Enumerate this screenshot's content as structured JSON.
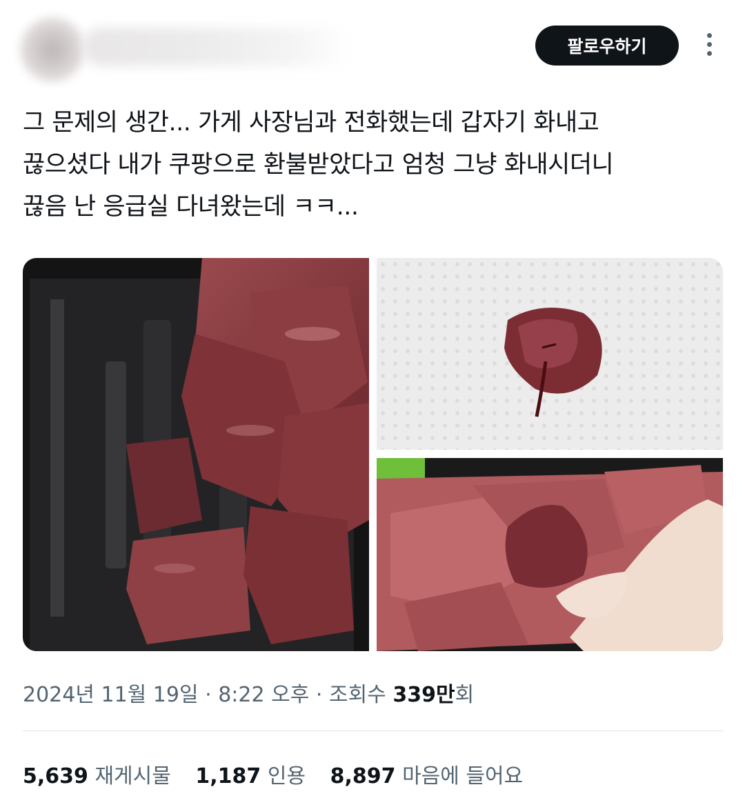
{
  "header": {
    "follow_label": "팔로우하기"
  },
  "tweet": {
    "lines": [
      "그 문제의 생간... 가게 사장님과 전화했는데 갑자기 화내고",
      "끊으셨다 내가 쿠팡으로 환불받았다고 엄청 그냥 화내시더니",
      "끊음 난 응급실 다녀왔는데 ㅋㅋ..."
    ]
  },
  "meta": {
    "date": "2024년 11월 19일",
    "separator": "·",
    "time": "8:22 오후",
    "views_label": "조회수",
    "views_count": "339만",
    "views_suffix": "회"
  },
  "stats": {
    "reposts_count": "5,639",
    "reposts_label": "재게시물",
    "quotes_count": "1,187",
    "quotes_label": "인용",
    "likes_count": "8,897",
    "likes_label": "마음에 들어요"
  },
  "colors": {
    "text_primary": "#0f1419",
    "text_secondary": "#536471",
    "button_bg": "#0f1419",
    "divider": "#dfe3e6",
    "liver": "#8a3c40",
    "tray": "#1c1c1e"
  },
  "icons": {
    "more": "more-dots-icon"
  }
}
